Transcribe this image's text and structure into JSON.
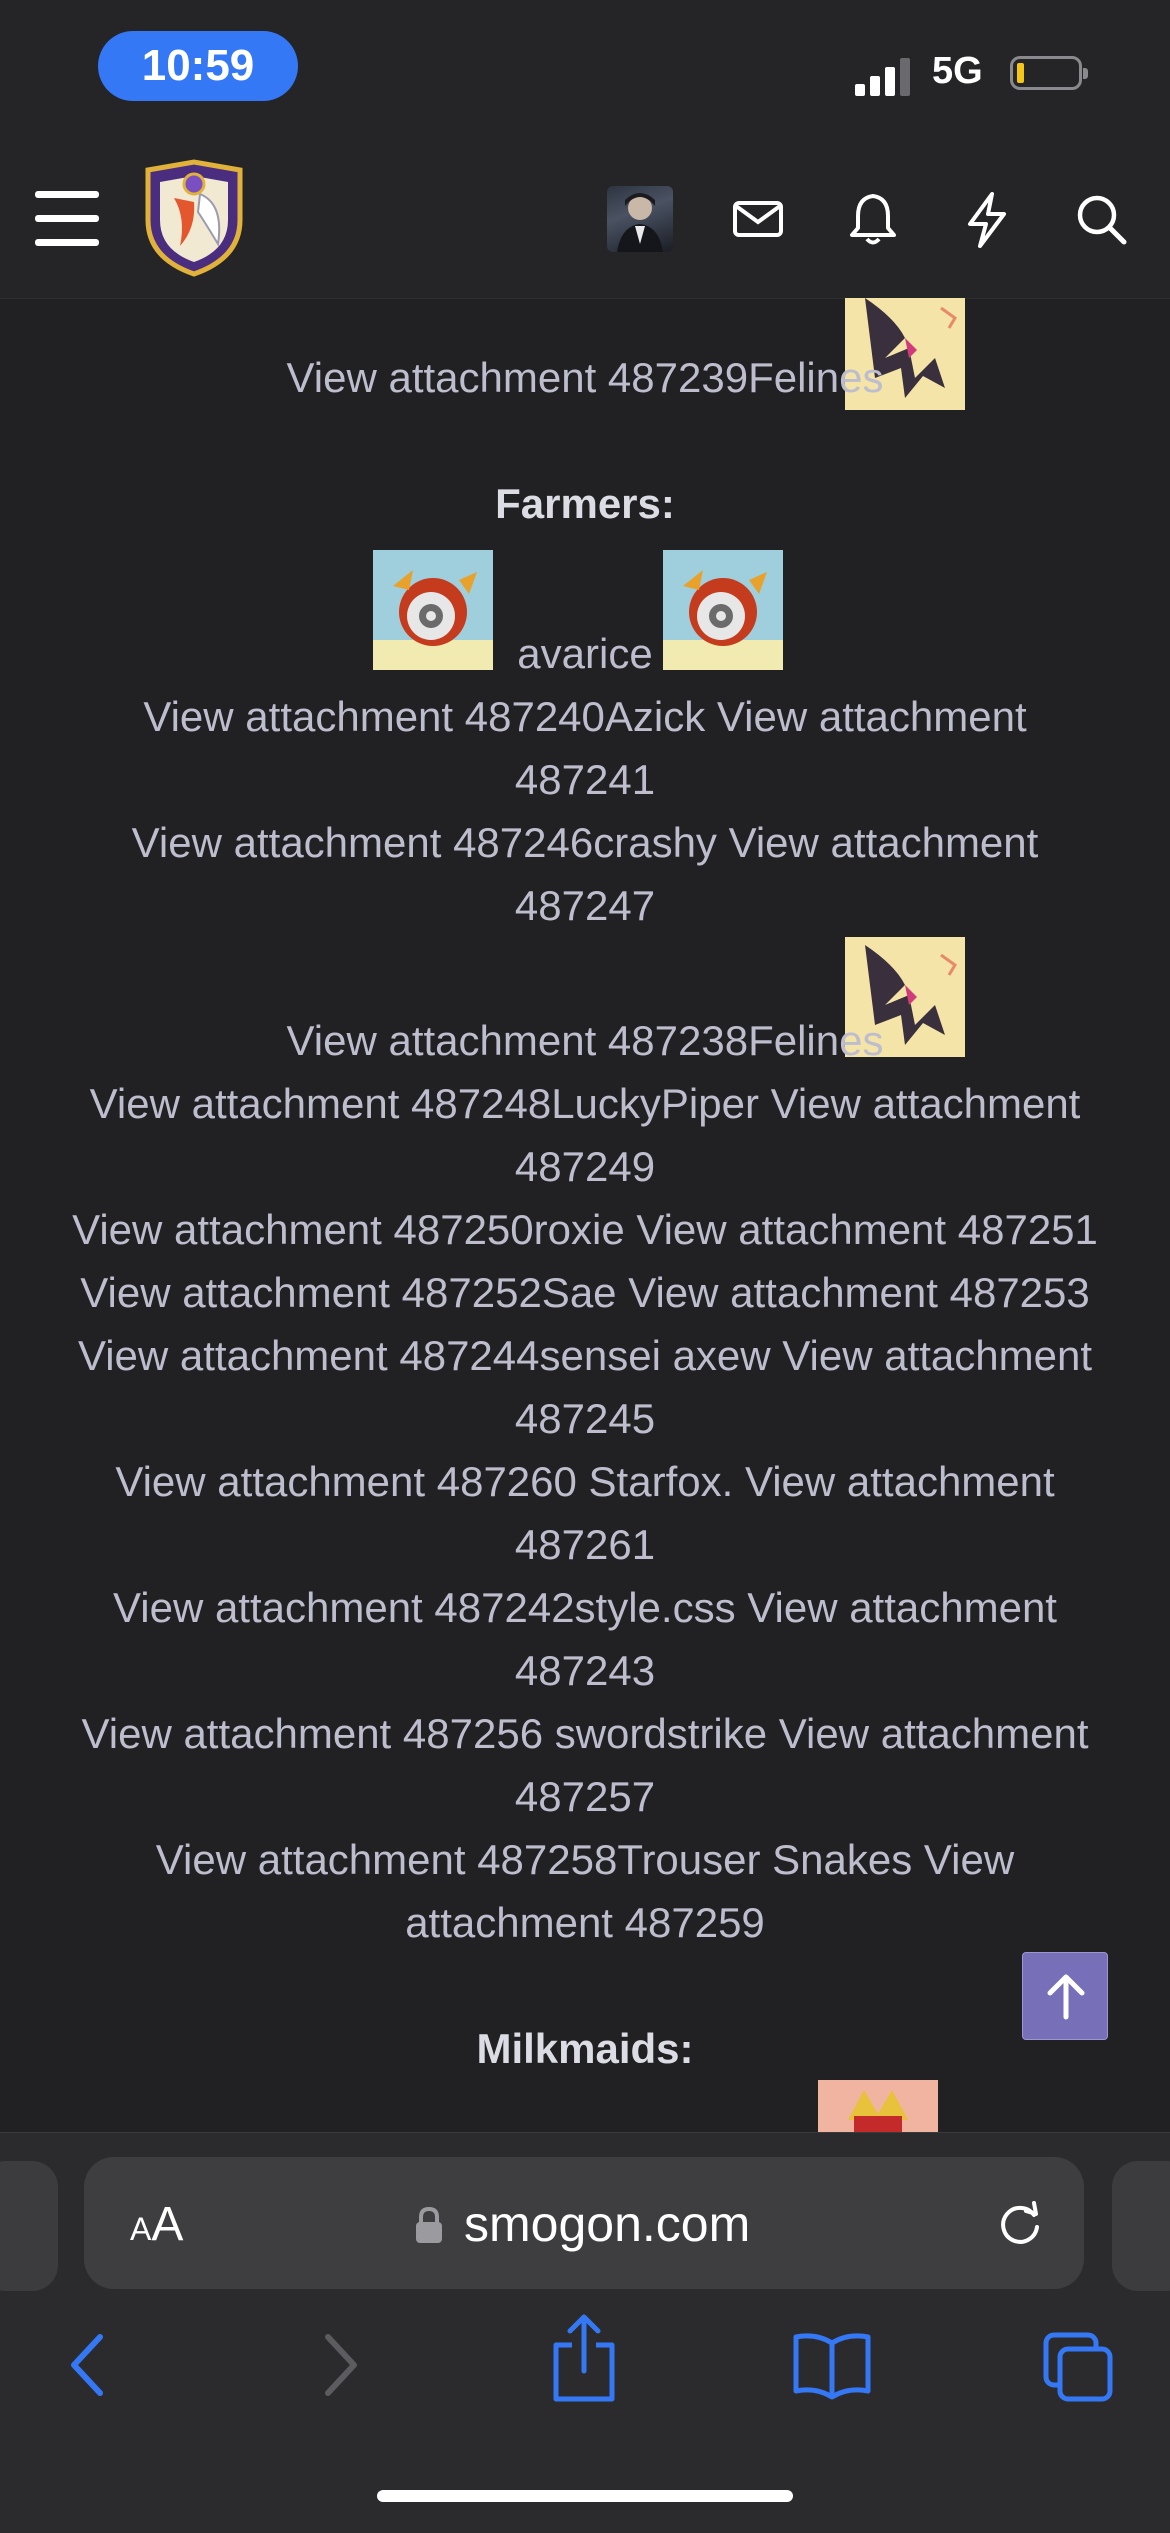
{
  "status_bar": {
    "time": "10:59",
    "network": "5G"
  },
  "content_lines": [
    "View attachment 487239Felines",
    "Farmers:",
    "avarice",
    "View attachment 487240Azick View attachment",
    "487241",
    "View attachment 487246crashy View attachment",
    "487247",
    "View attachment 487238Felines",
    "View attachment 487248LuckyPiper View attachment",
    "487249",
    "View attachment 487250roxie View attachment 487251",
    "View attachment 487252Sae View attachment 487253",
    "View attachment 487244sensei axew View attachment",
    "487245",
    "View attachment 487260 Starfox. View attachment",
    "487261",
    "View attachment 487242style.css View attachment",
    "487243",
    "View attachment 487256 swordstrike View attachment",
    "487257",
    "View attachment 487258Trouser Snakes View",
    "attachment 487259",
    "Milkmaids:"
  ],
  "url_bar": {
    "aa_label": "AA",
    "domain": "smogon.com"
  },
  "icons": [
    "menu-icon",
    "site-logo",
    "avatar",
    "mail-icon",
    "bell-icon",
    "lightning-icon",
    "search-icon",
    "scroll-to-top-icon",
    "lock-icon",
    "reload-icon",
    "back-icon",
    "forward-icon",
    "share-icon",
    "bookmarks-icon",
    "tabs-icon"
  ],
  "colors": {
    "background": "#212123",
    "accent": "#3478f6",
    "scroll_top_button": "#7770b8"
  }
}
